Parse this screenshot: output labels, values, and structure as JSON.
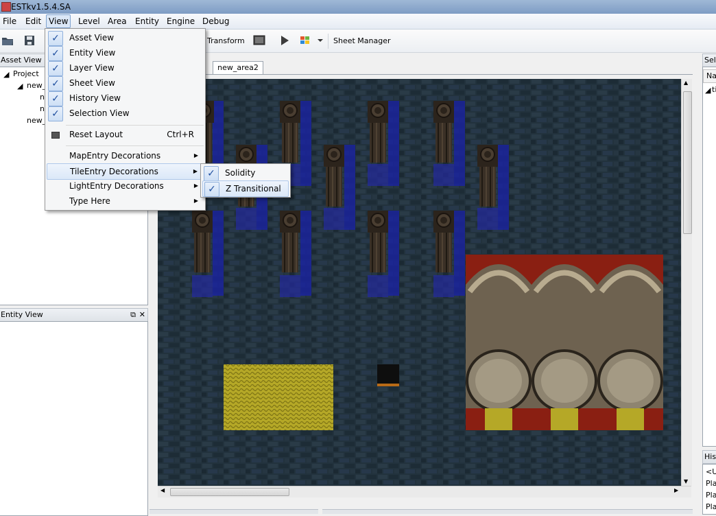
{
  "window": {
    "title": "ESTkv1.5.4.SA"
  },
  "menubar": {
    "items": [
      "File",
      "Edit",
      "View",
      "Level",
      "Area",
      "Entity",
      "Engine",
      "Debug"
    ],
    "active": "View"
  },
  "toolbar": {
    "transform_label": "Transform",
    "sheet_manager_label": "Sheet Manager"
  },
  "asset_view": {
    "title": "Asset View",
    "tree": [
      {
        "label": "Project"
      },
      {
        "label": "new_"
      },
      {
        "label": "n"
      },
      {
        "label": "n"
      },
      {
        "label": "new_"
      }
    ]
  },
  "entity_view": {
    "title": "Entity View"
  },
  "editor": {
    "tabs": [
      "new_area2"
    ]
  },
  "right_panel": {
    "selection_title": "Sele",
    "name_header": "Na",
    "tree_item": "til",
    "history_title": "Hist",
    "history_items": [
      "<U",
      "Pla",
      "Pla",
      "Pla"
    ]
  },
  "view_menu": {
    "items": [
      {
        "label": "Asset View",
        "checked": true
      },
      {
        "label": "Entity View",
        "checked": true
      },
      {
        "label": "Layer View",
        "checked": true
      },
      {
        "label": "Sheet View",
        "checked": true
      },
      {
        "label": "History View",
        "checked": true
      },
      {
        "label": "Selection View",
        "checked": true
      }
    ],
    "reset_layout": {
      "label": "Reset Layout",
      "shortcut": "Ctrl+R"
    },
    "submenus": [
      "MapEntry Decorations",
      "TileEntry Decorations",
      "LightEntry Decorations",
      "Type Here"
    ],
    "highlighted_submenu": "TileEntry Decorations"
  },
  "tileentry_submenu": {
    "items": [
      {
        "label": "Solidity",
        "checked": true
      },
      {
        "label": "Z Transitional",
        "checked": true
      }
    ]
  },
  "colors": {
    "wall_dark": "#1e2d38",
    "wall_mortar": "#0d151b",
    "pillar": "#3a2f24",
    "overlay_blue": "#1a22a8",
    "mat_yellow": "#b0a526",
    "barrel_red": "#8a1f12"
  },
  "icons": [
    "open-folder-icon",
    "save-icon",
    "monitor-icon",
    "play-icon",
    "windows-flag-icon",
    "dropdown-arrow-icon",
    "restore-icon",
    "close-icon",
    "check-icon",
    "submenu-arrow-icon"
  ]
}
